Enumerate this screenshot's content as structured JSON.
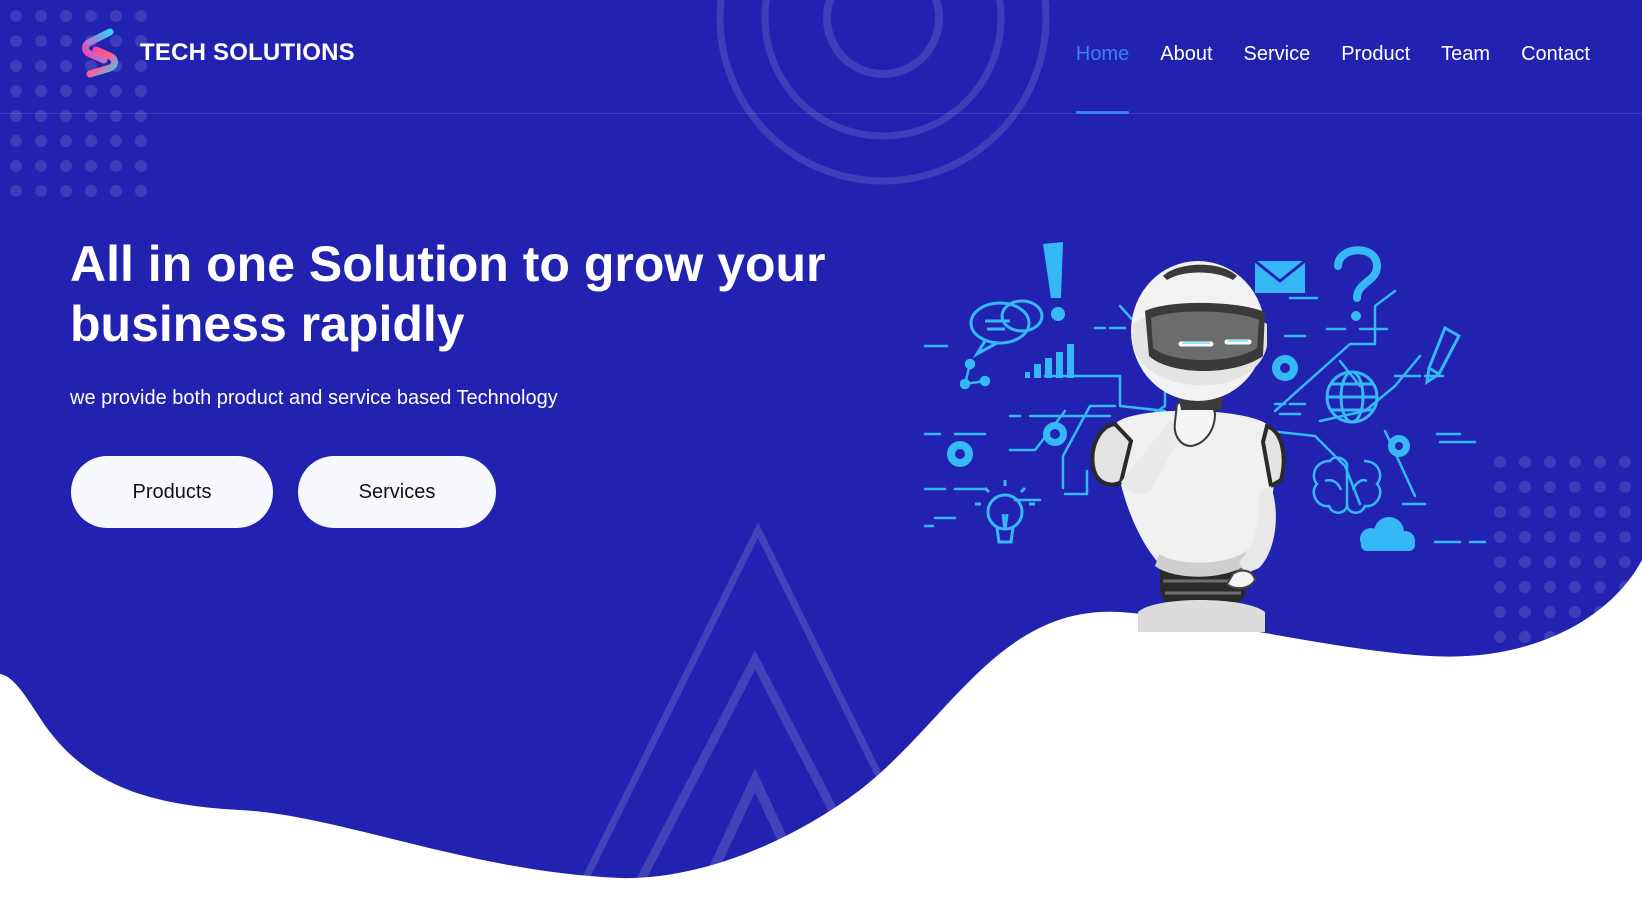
{
  "brand": {
    "name": "TECH SOLUTIONS",
    "logo_icon": "s-logo-icon"
  },
  "nav": {
    "items": [
      {
        "label": "Home",
        "active": true
      },
      {
        "label": "About",
        "active": false
      },
      {
        "label": "Service",
        "active": false
      },
      {
        "label": "Product",
        "active": false
      },
      {
        "label": "Team",
        "active": false
      },
      {
        "label": "Contact",
        "active": false
      }
    ]
  },
  "hero": {
    "headline_line1": "All in one Solution to grow your",
    "headline_line2": "business rapidly",
    "subtext": "we provide both product and service based Technology",
    "buttons": {
      "products": "Products",
      "services": "Services"
    }
  },
  "illustration": {
    "subject": "robot-thinking",
    "icons": [
      "exclamation-icon",
      "question-icon",
      "mail-icon",
      "chat-icon",
      "bar-chart-icon",
      "network-icon",
      "gear-icon",
      "lightbulb-icon",
      "globe-icon",
      "brain-icon",
      "cloud-icon",
      "pencil-icon"
    ]
  },
  "colors": {
    "background": "#2123b0",
    "accent": "#3d7bff",
    "illustration_lines": "#35b8f5",
    "button_bg": "#f6f8fe",
    "text": "#ffffff"
  }
}
